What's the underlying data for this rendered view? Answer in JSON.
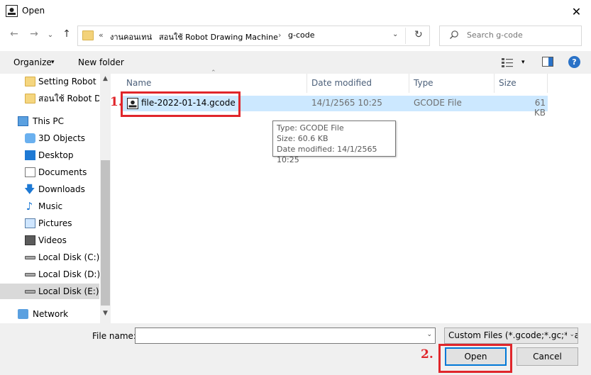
{
  "window": {
    "title": "Open",
    "close_glyph": "✕"
  },
  "nav_buttons": {
    "back": "←",
    "forward": "→",
    "recent": "⌄",
    "up": "↑"
  },
  "address": {
    "overflow": "«",
    "separator": "›",
    "crumbs": [
      "งานคอนเทน",
      "สอนใช้ Robot Drawing Machine",
      "g-code"
    ],
    "dropdown": "⌄",
    "refresh": "↻"
  },
  "search": {
    "placeholder": "Search g-code"
  },
  "toolbar": {
    "organize": "Organize",
    "new_folder": "New folder",
    "caret": "▾"
  },
  "nav": {
    "items": [
      {
        "label": "Setting Robot Dr",
        "icon": "folder-icon"
      },
      {
        "label": "สอนใช้ Robot Dra",
        "icon": "folder-icon"
      },
      {
        "label": "This PC",
        "icon": "pc-icon"
      },
      {
        "label": "3D Objects",
        "icon": "3d-objects-icon"
      },
      {
        "label": "Desktop",
        "icon": "desktop-icon"
      },
      {
        "label": "Documents",
        "icon": "documents-icon"
      },
      {
        "label": "Downloads",
        "icon": "downloads-icon"
      },
      {
        "label": "Music",
        "icon": "music-icon"
      },
      {
        "label": "Pictures",
        "icon": "pictures-icon"
      },
      {
        "label": "Videos",
        "icon": "videos-icon"
      },
      {
        "label": "Local Disk (C:)",
        "icon": "disk-icon"
      },
      {
        "label": "Local Disk (D:)",
        "icon": "disk-icon"
      },
      {
        "label": "Local Disk (E:)",
        "icon": "disk-icon"
      },
      {
        "label": "Network",
        "icon": "network-icon"
      }
    ],
    "scroll_up": "▲",
    "scroll_down": "▼",
    "music_glyph": "♪",
    "download_glyph": "🡇"
  },
  "columns": {
    "name": "Name",
    "date": "Date modified",
    "type": "Type",
    "size": "Size",
    "sort_glyph": "⌃"
  },
  "files": [
    {
      "name": "file-2022-01-14.gcode",
      "date": "14/1/2565 10:25",
      "type": "GCODE File",
      "size": "61 KB"
    }
  ],
  "tooltip": {
    "line1": "Type: GCODE File",
    "line2": "Size: 60.6 KB",
    "line3": "Date modified: 14/1/2565 10:25"
  },
  "annotations": {
    "step1": "1.",
    "step2": "2.",
    "highlight_color": "#e0262b"
  },
  "bottom": {
    "filename_label": "File name:",
    "filename_value": "",
    "filename_dd": "⌄",
    "filetype": "Custom Files (*.gcode;*.gc;*.tap",
    "filetype_dd": "⌄",
    "open": "Open",
    "cancel": "Cancel"
  },
  "colors": {
    "selection": "#cce8ff",
    "accent": "#0078d7",
    "header_text": "#4c607a"
  }
}
